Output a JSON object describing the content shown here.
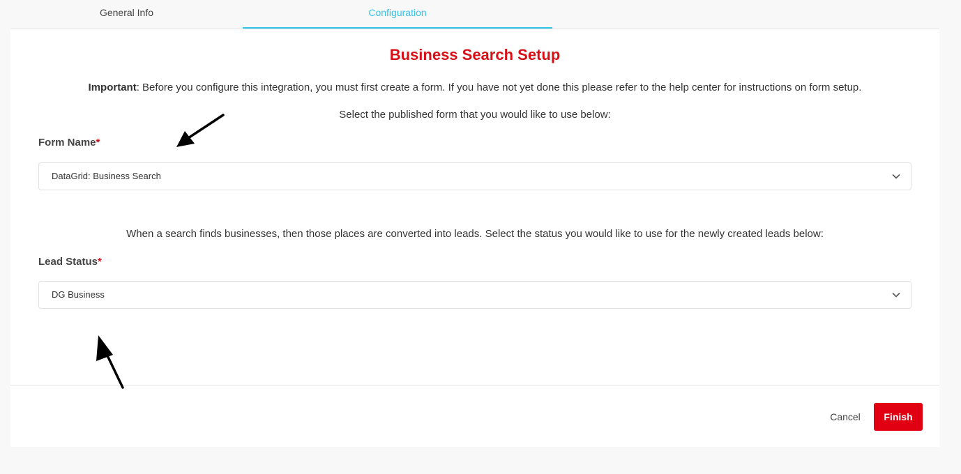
{
  "tabs": [
    {
      "label": "General Info",
      "active": false
    },
    {
      "label": "Configuration",
      "active": true
    }
  ],
  "setup": {
    "title": "Business Search Setup",
    "important_label": "Important",
    "important_text": ": Before you configure this integration, you must first create a form. If you have not yet done this please refer to the help center for instructions on form setup.",
    "form_instruction": "Select the published form that you would like to use below:",
    "status_instruction": "When a search finds businesses, then those places are converted into leads. Select the status you would like to use for the newly created leads below:"
  },
  "form_name": {
    "label": "Form Name",
    "required_mark": "*",
    "value": "DataGrid: Business Search"
  },
  "lead_status": {
    "label": "Lead Status",
    "required_mark": "*",
    "value": "DG Business"
  },
  "footer": {
    "cancel_label": "Cancel",
    "finish_label": "Finish"
  },
  "colors": {
    "accent": "#35c3ea",
    "brand_red": "#d70f17",
    "finish_bg": "#e00012"
  },
  "icons": {
    "select_chevron": "chevron-down-icon",
    "annotation_arrows": "arrow-icon"
  }
}
